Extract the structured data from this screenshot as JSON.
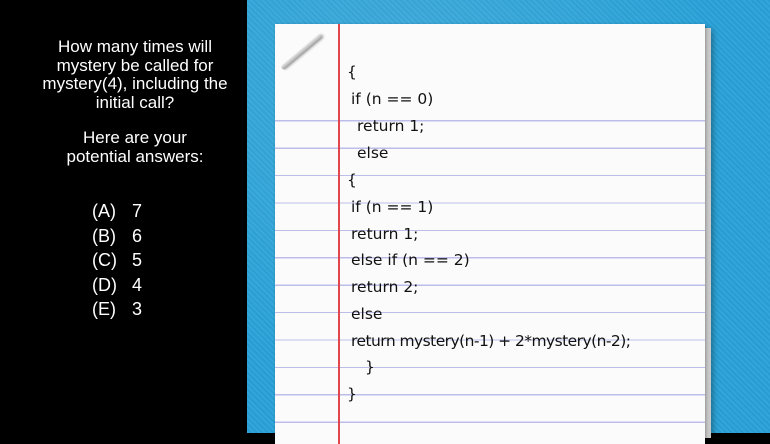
{
  "question": {
    "lines": [
      "How many times will",
      "mystery be called for",
      "mystery(4), including the",
      "initial call?"
    ]
  },
  "answers_intro": {
    "lines": [
      "Here are your",
      "potential answers:"
    ]
  },
  "answers": [
    {
      "letter": "(A)",
      "value": "7"
    },
    {
      "letter": "(B)",
      "value": "6"
    },
    {
      "letter": "(C)",
      "value": "5"
    },
    {
      "letter": "(D)",
      "value": "4"
    },
    {
      "letter": "(E)",
      "value": "3"
    }
  ],
  "code": {
    "lines": [
      "{",
      "if (n == 0)",
      "return 1;",
      "else",
      "{",
      "if (n == 1)",
      "return 1;",
      "else if (n == 2)",
      "return 2;",
      "else",
      "return mystery(n-1) + 2*mystery(n-2);",
      "}",
      "}"
    ]
  },
  "colors": {
    "background_left": "#000000",
    "background_right": "#2aa2d8",
    "paper": "#fbfbfb",
    "rule_line": "#bcbde8",
    "margin_line": "#e0464c"
  }
}
